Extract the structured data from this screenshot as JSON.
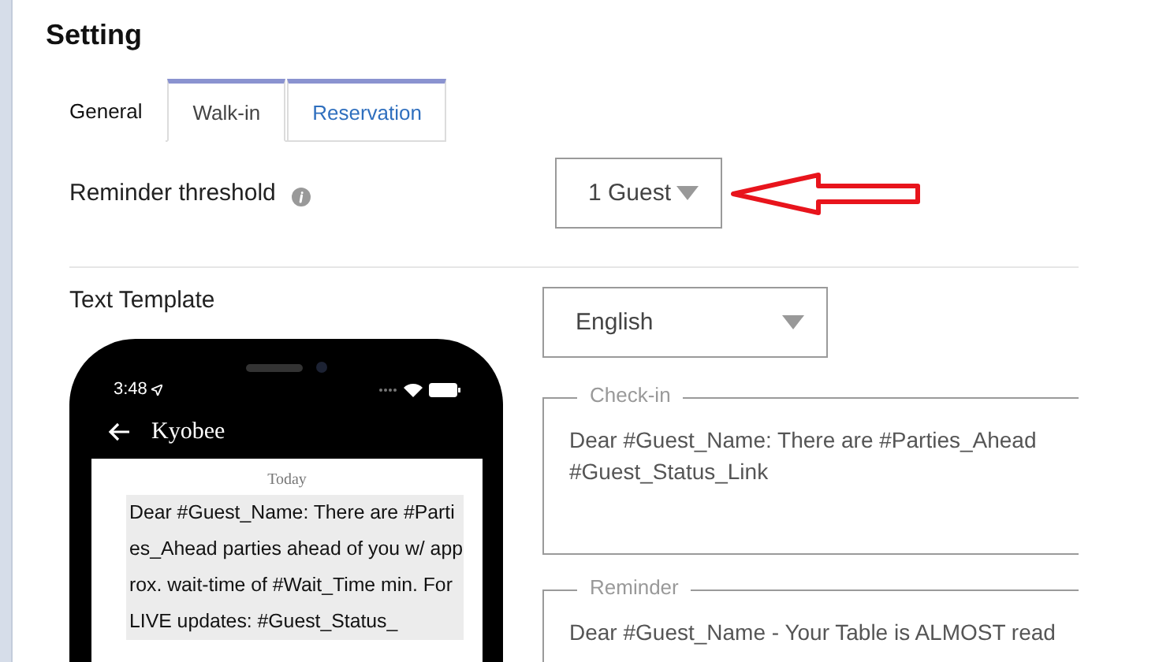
{
  "page": {
    "title": "Setting"
  },
  "tabs": [
    {
      "label": "General",
      "selected": false,
      "kind": "plain"
    },
    {
      "label": "Walk-in",
      "selected": true,
      "kind": "boxed"
    },
    {
      "label": "Reservation",
      "selected": false,
      "kind": "boxed"
    }
  ],
  "reminder_threshold": {
    "label": "Reminder threshold",
    "value": "1 Guest"
  },
  "text_template": {
    "label": "Text Template",
    "language": "English",
    "templates": [
      {
        "legend": "Check-in",
        "value": "Dear #Guest_Name: There are #Parties_Ahead\n#Guest_Status_Link"
      },
      {
        "legend": "Reminder",
        "value": "Dear #Guest_Name - Your Table is ALMOST read"
      }
    ]
  },
  "phone_preview": {
    "time": "3:48",
    "contact": "Kyobee",
    "date": "Today",
    "message": "Dear #Guest_Name: There are #Parties_Ahead parties ahead of you w/ approx. wait-time of #Wait_Time min. For LIVE updates: #Guest_Status_"
  }
}
